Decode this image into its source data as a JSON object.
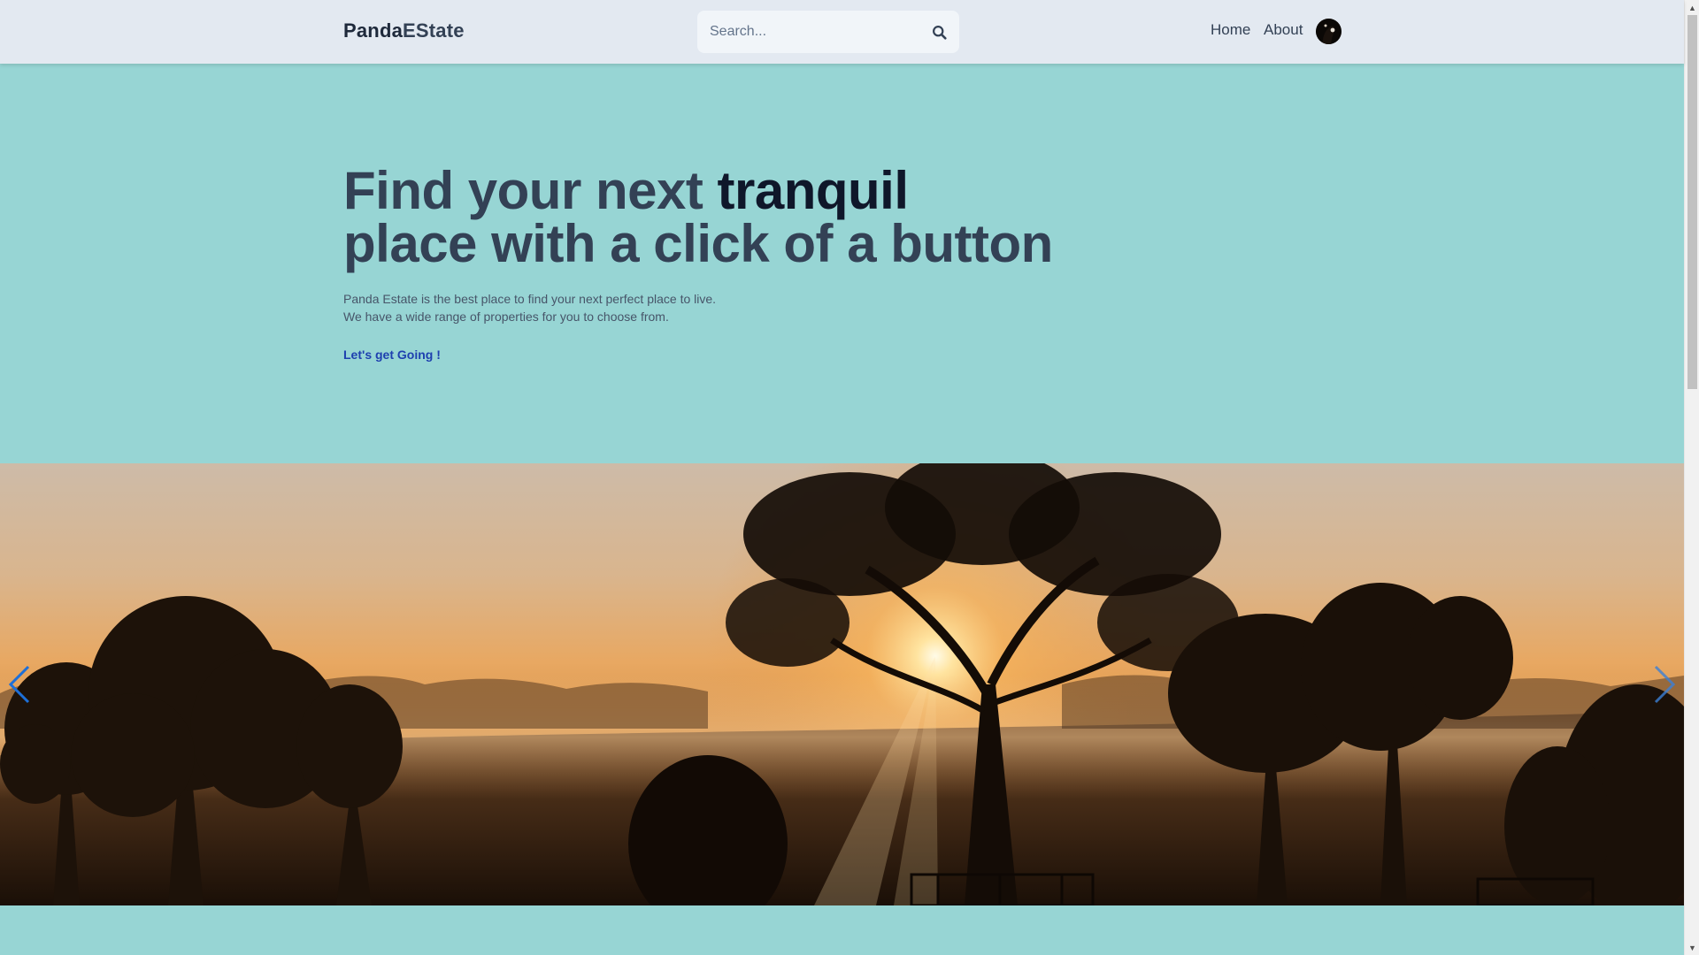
{
  "header": {
    "brand_part1": "Panda",
    "brand_part2": "EState",
    "search_placeholder": "Search...",
    "nav_home": "Home",
    "nav_about": "About"
  },
  "hero": {
    "title_line1_start": "Find your next ",
    "title_emphasis": "tranquil",
    "title_line2": "place with a click of a button",
    "desc_line1": "Panda Estate is the best place to find your next perfect place to live.",
    "desc_line2": "We have a wide range of properties for you to choose from.",
    "cta_label": "Let's get Going !"
  },
  "carousel": {
    "image_subject": "misty sunrise behind silhouetted trees",
    "prev_icon": "chevron-left-icon",
    "next_icon": "chevron-right-icon"
  },
  "colors": {
    "page_background": "#97d5d4",
    "header_background": "#e3e9f1",
    "title_text": "#334155",
    "title_emphasis": "#0f172a",
    "cta_link": "#1e40af",
    "carousel_arrow": "#1d6fd8"
  }
}
